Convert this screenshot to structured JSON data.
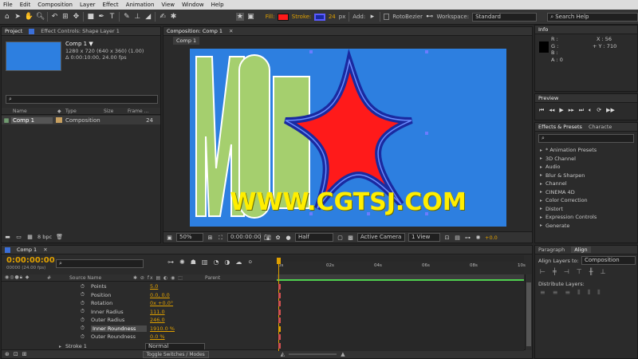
{
  "menu": [
    "File",
    "Edit",
    "Composition",
    "Layer",
    "Effect",
    "Animation",
    "View",
    "Window",
    "Help"
  ],
  "toolbar": {
    "fill_label": "Fill:",
    "fill_color": "#ff1a1a",
    "stroke_label": "Stroke:",
    "stroke_color": "#1a2aa0",
    "stroke_px": "24",
    "stroke_px_unit": "px",
    "add_label": "Add:",
    "rotobezier_label": "RotoBezier",
    "workspace_label": "Workspace:",
    "workspace_value": "Standard",
    "help_placeholder": "Search Help"
  },
  "project": {
    "tabs": [
      "Project",
      "Effect Controls: Shape Layer 1"
    ],
    "comp_name": "Comp 1 ▼",
    "comp_size": "1280 x 720  (640 x 360) (1.00)",
    "comp_duration": "Δ 0:00:10:00, 24.00 fps",
    "search_placeholder": "",
    "columns": [
      "Name",
      "Type",
      "Size",
      "Frame ..."
    ],
    "items": [
      {
        "name": "Comp 1",
        "type": "Composition",
        "size": "",
        "frame": "24"
      }
    ],
    "bpc": "8 bpc"
  },
  "composition": {
    "tab": "Composition: Comp 1",
    "subtab": "Comp 1",
    "zoom": "50%",
    "timecode": "0:00:00:00",
    "resolution": "Half",
    "camera": "Active Camera",
    "views": "1 View",
    "exposure": "+0.0",
    "watermark": "WWW.CGTSJ.COM"
  },
  "info": {
    "tab": "Info",
    "r": "R :",
    "g": "G :",
    "b": "B :",
    "a": "A : 0",
    "x": "X : 56",
    "y": "+ Y : 710"
  },
  "preview": {
    "tab": "Preview"
  },
  "effects": {
    "tabs": [
      "Effects & Presets",
      "Characte"
    ],
    "search_placeholder": "",
    "items": [
      "* Animation Presets",
      "3D Channel",
      "Audio",
      "Blur & Sharpen",
      "Channel",
      "CINEMA 4D",
      "Color Correction",
      "Distort",
      "Expression Controls",
      "Generate"
    ]
  },
  "align": {
    "tabs": [
      "Paragraph",
      "Align"
    ],
    "align_layers_to": "Align Layers to:",
    "align_target": "Composition",
    "distribute": "Distribute Layers:"
  },
  "timeline": {
    "tab": "Comp 1",
    "timecode": "0:00:00:00",
    "fps_line": "00000 (24.00 fps)",
    "search_placeholder": "",
    "col_source": "Source Name",
    "col_parent": "Parent",
    "ruler": [
      "0s",
      "02s",
      "04s",
      "06s",
      "08s",
      "10s"
    ],
    "properties": [
      {
        "name": "Points",
        "value": "5.0"
      },
      {
        "name": "Position",
        "value": "0.0, 0.0"
      },
      {
        "name": "Rotation",
        "value": "0x +0.0°"
      },
      {
        "name": "Inner Radius",
        "value": "111.0"
      },
      {
        "name": "Outer Radius",
        "value": "246.0"
      },
      {
        "name": "Inner Roundness",
        "value": "1910.0 %"
      },
      {
        "name": "Outer Roundness",
        "value": "0.0 %"
      }
    ],
    "stroke_row": "Stroke 1",
    "stroke_mode": "Normal",
    "toggle_label": "Toggle Switches / Modes"
  }
}
